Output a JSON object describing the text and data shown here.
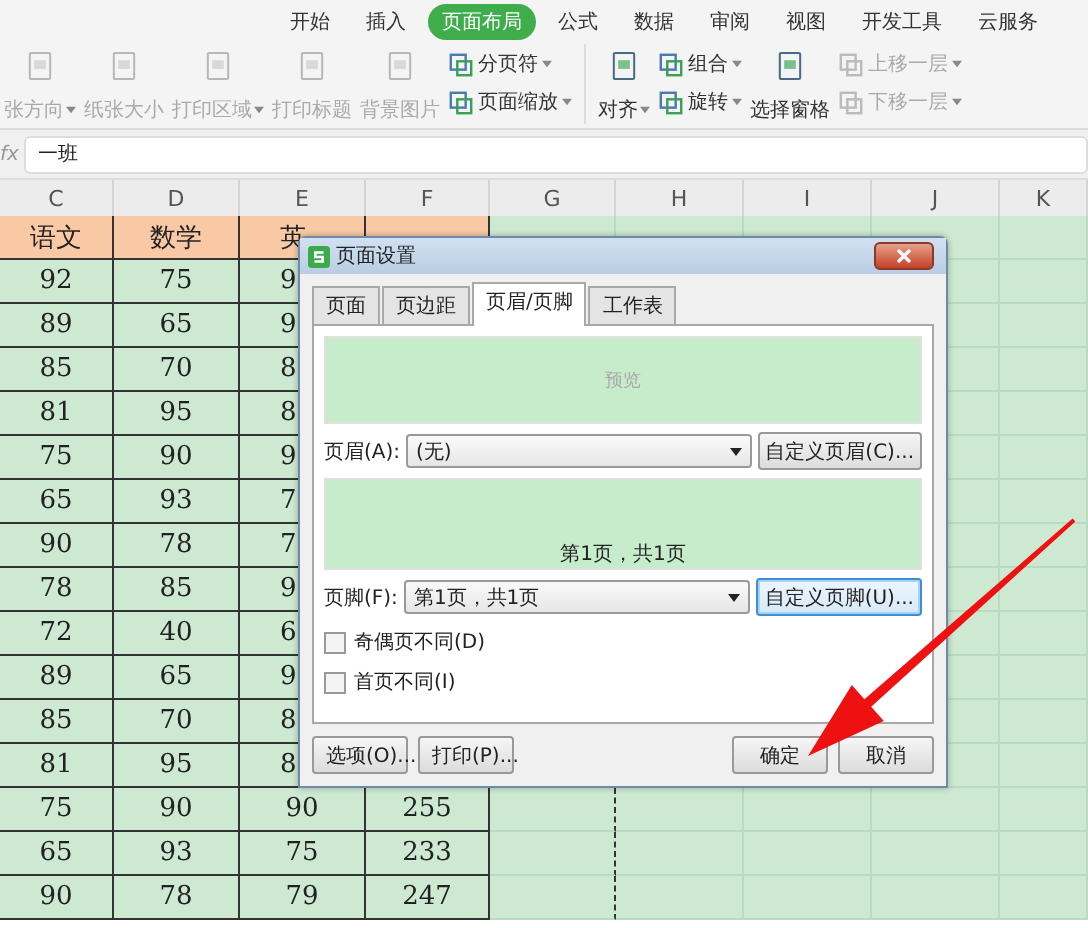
{
  "ribbon": {
    "tabs": [
      {
        "label": "开始",
        "selected": false
      },
      {
        "label": "插入",
        "selected": false
      },
      {
        "label": "页面布局",
        "selected": true
      },
      {
        "label": "公式",
        "selected": false
      },
      {
        "label": "数据",
        "selected": false
      },
      {
        "label": "审阅",
        "selected": false
      },
      {
        "label": "视图",
        "selected": false
      },
      {
        "label": "开发工具",
        "selected": false
      },
      {
        "label": "云服务",
        "selected": false
      }
    ],
    "groups": [
      [
        {
          "kind": "large",
          "label": "张方向",
          "disabled": true,
          "dropdown": true
        },
        {
          "kind": "large",
          "label": "纸张大小",
          "disabled": true,
          "dropdown": false
        },
        {
          "kind": "large",
          "label": "打印区域",
          "disabled": true,
          "dropdown": true
        },
        {
          "kind": "large",
          "label": "打印标题",
          "disabled": true,
          "dropdown": false
        },
        {
          "kind": "large",
          "label": "背景图片",
          "disabled": true,
          "dropdown": false
        },
        {
          "kind": "stack",
          "items": [
            {
              "label": "分页符",
              "disabled": false,
              "dropdown": true
            },
            {
              "label": "页面缩放",
              "disabled": false,
              "dropdown": true
            }
          ]
        }
      ],
      [
        {
          "kind": "large",
          "label": "对齐",
          "disabled": false,
          "dropdown": true
        },
        {
          "kind": "stack",
          "items": [
            {
              "label": "组合",
              "disabled": false,
              "dropdown": true
            },
            {
              "label": "旋转",
              "disabled": false,
              "dropdown": true
            }
          ]
        },
        {
          "kind": "large",
          "label": "选择窗格",
          "disabled": false,
          "dropdown": false
        },
        {
          "kind": "stack",
          "items": [
            {
              "label": "上移一层",
              "disabled": true,
              "dropdown": true
            },
            {
              "label": "下移一层",
              "disabled": true,
              "dropdown": true
            }
          ]
        }
      ]
    ]
  },
  "formula_bar": {
    "label": "fx",
    "value": "一班"
  },
  "sheet": {
    "columns": [
      "C",
      "D",
      "E",
      "F",
      "G",
      "H",
      "I",
      "J",
      "K"
    ],
    "header_row": [
      "语文",
      "数学",
      "英"
    ],
    "rows": [
      [
        "92",
        "75",
        "9"
      ],
      [
        "89",
        "65",
        "9"
      ],
      [
        "85",
        "70",
        "8"
      ],
      [
        "81",
        "95",
        "8"
      ],
      [
        "75",
        "90",
        "9"
      ],
      [
        "65",
        "93",
        "7"
      ],
      [
        "90",
        "78",
        "7"
      ],
      [
        "78",
        "85",
        "9"
      ],
      [
        "72",
        "40",
        "6"
      ],
      [
        "89",
        "65",
        "9"
      ],
      [
        "85",
        "70",
        "8"
      ],
      [
        "81",
        "95",
        "8"
      ],
      [
        "75",
        "90",
        "90",
        "255"
      ],
      [
        "65",
        "93",
        "75",
        "233"
      ],
      [
        "90",
        "78",
        "79",
        "247"
      ]
    ]
  },
  "dialog": {
    "title": "页面设置",
    "tabs": [
      {
        "label": "页面",
        "selected": false
      },
      {
        "label": "页边距",
        "selected": false
      },
      {
        "label": "页眉/页脚",
        "selected": true
      },
      {
        "label": "工作表",
        "selected": false
      }
    ],
    "header_preview": "预览",
    "header": {
      "label": "页眉(A):",
      "value": "(无)",
      "button": "自定义页眉(C)...",
      "focused": false
    },
    "footer_preview": "第1页，共1页",
    "footer": {
      "label": "页脚(F):",
      "value": "第1页，共1页",
      "button": "自定义页脚(U)...",
      "focused": true
    },
    "checkboxes": [
      {
        "label": "奇偶页不同(D)",
        "checked": false
      },
      {
        "label": "首页不同(I)",
        "checked": false
      }
    ],
    "left_buttons": [
      "选项(O)...",
      "打印(P)..."
    ],
    "right_buttons": [
      "确定",
      "取消"
    ]
  }
}
